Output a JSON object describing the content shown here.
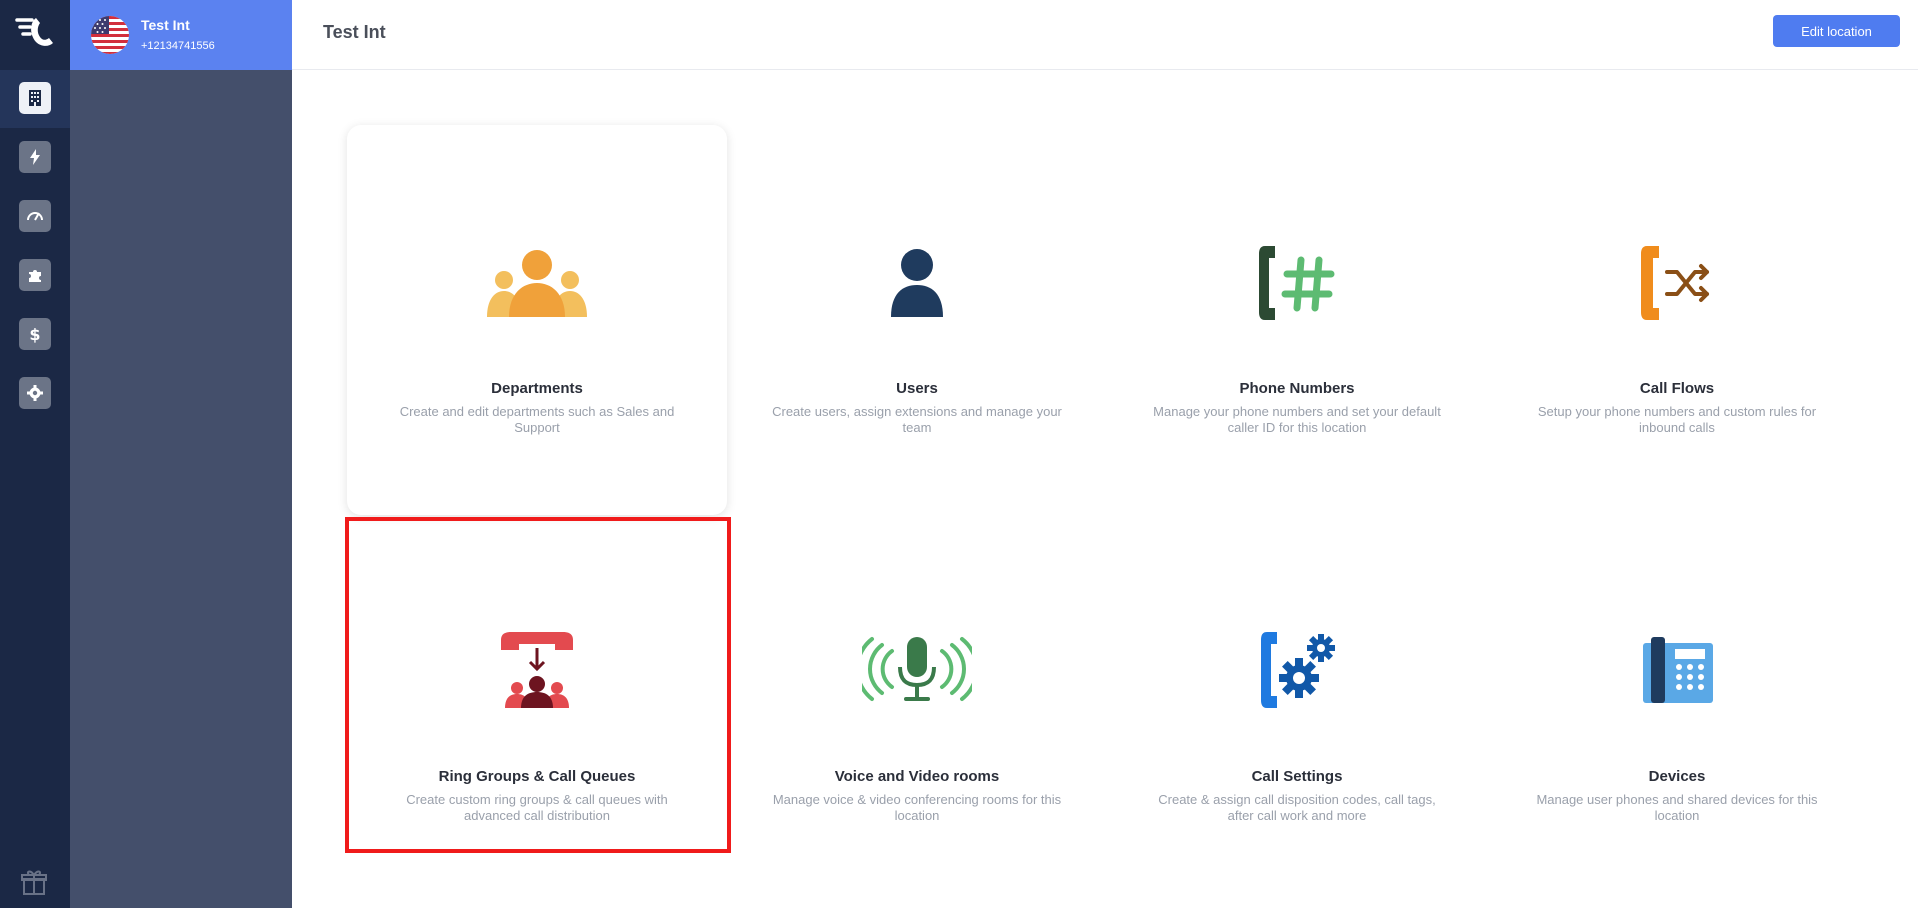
{
  "location": {
    "name": "Test Int",
    "phone": "+12134741556"
  },
  "header": {
    "title": "Test Int",
    "edit_button": "Edit location"
  },
  "rail": {
    "items": [
      {
        "icon": "building-icon",
        "active": true
      },
      {
        "icon": "lightning-icon",
        "active": false
      },
      {
        "icon": "speedometer-icon",
        "active": false
      },
      {
        "icon": "puzzle-icon",
        "active": false
      },
      {
        "icon": "dollar-icon",
        "active": false
      },
      {
        "icon": "gear-icon",
        "active": false
      }
    ],
    "bottom_icon": "gift-icon"
  },
  "cards": [
    {
      "title": "Departments",
      "desc": "Create and edit departments such as Sales and Support",
      "icon": "departments-icon",
      "color": "#f0a13a"
    },
    {
      "title": "Users",
      "desc": "Create users, assign extensions and manage your team",
      "icon": "user-icon",
      "color": "#1f3b5e"
    },
    {
      "title": "Phone Numbers",
      "desc": "Manage your phone numbers and set your default caller ID for this location",
      "icon": "phone-hash-icon",
      "color": "#2c4a33"
    },
    {
      "title": "Call Flows",
      "desc": "Setup your phone numbers and custom rules for inbound calls",
      "icon": "call-flows-icon",
      "color": "#f08c1c"
    },
    {
      "title": "Ring Groups & Call Queues",
      "desc": "Create custom ring groups & call queues with advanced call distribution",
      "icon": "ring-groups-icon",
      "color": "#e34a4f"
    },
    {
      "title": "Voice and Video rooms",
      "desc": "Manage voice & video conferencing rooms for this location",
      "icon": "microphone-icon",
      "color": "#3a7a4a"
    },
    {
      "title": "Call Settings",
      "desc": "Create & assign call disposition codes, call tags, after call work and more",
      "icon": "call-settings-icon",
      "color": "#1f7ae0"
    },
    {
      "title": "Devices",
      "desc": "Manage user phones and shared devices for this location",
      "icon": "desk-phone-icon",
      "color": "#5aa8e6"
    }
  ]
}
